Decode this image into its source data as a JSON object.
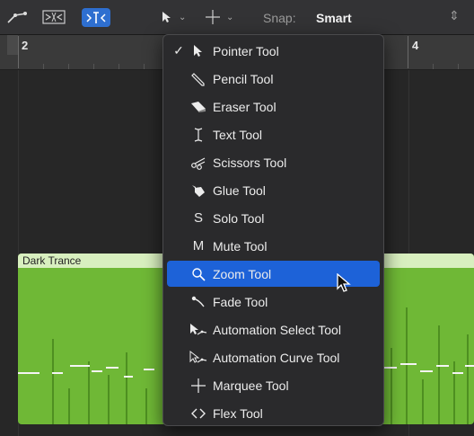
{
  "toolbar": {
    "snap_label": "Snap:",
    "snap_value": "Smart",
    "left_tool_icon": "pointer-icon",
    "right_tool_icon": "marquee-crosshair-icon"
  },
  "ruler": {
    "markers": [
      "2",
      "4"
    ]
  },
  "region": {
    "name": "Dark Trance",
    "color": "#6fb836",
    "header_color": "#d8efbf"
  },
  "menu": {
    "highlight_color": "#1d62d8",
    "items": [
      {
        "label": "Pointer Tool",
        "icon": "pointer-icon",
        "checked": true
      },
      {
        "label": "Pencil Tool",
        "icon": "pencil-icon",
        "checked": false
      },
      {
        "label": "Eraser Tool",
        "icon": "eraser-icon",
        "checked": false
      },
      {
        "label": "Text Tool",
        "icon": "text-cursor-icon",
        "checked": false
      },
      {
        "label": "Scissors Tool",
        "icon": "scissors-icon",
        "checked": false
      },
      {
        "label": "Glue Tool",
        "icon": "glue-icon",
        "checked": false
      },
      {
        "label": "Solo Tool",
        "icon": "solo-icon",
        "checked": false
      },
      {
        "label": "Mute Tool",
        "icon": "mute-icon",
        "checked": false
      },
      {
        "label": "Zoom Tool",
        "icon": "magnifier-icon",
        "checked": false,
        "highlighted": true
      },
      {
        "label": "Fade Tool",
        "icon": "fade-icon",
        "checked": false
      },
      {
        "label": "Automation Select Tool",
        "icon": "automation-select-icon",
        "checked": false
      },
      {
        "label": "Automation Curve Tool",
        "icon": "automation-curve-icon",
        "checked": false
      },
      {
        "label": "Marquee Tool",
        "icon": "marquee-icon",
        "checked": false
      },
      {
        "label": "Flex Tool",
        "icon": "flex-icon",
        "checked": false
      }
    ]
  }
}
